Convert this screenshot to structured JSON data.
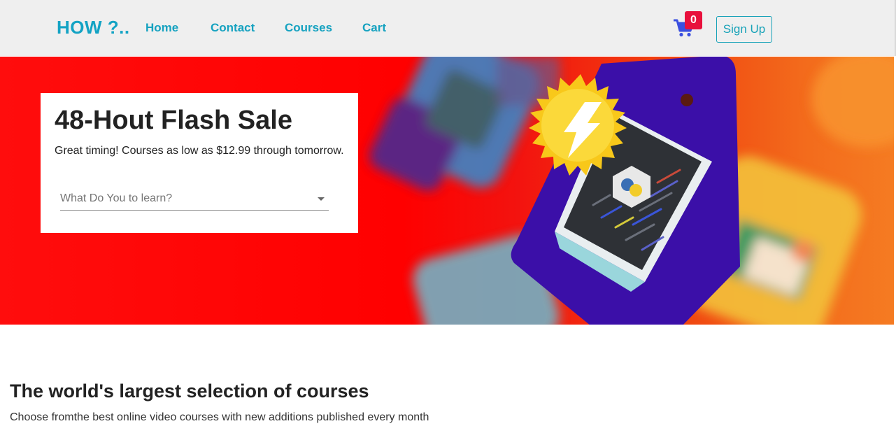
{
  "navbar": {
    "brand": "HOW ?..",
    "links": [
      "Home",
      "Contact",
      "Courses",
      "Cart"
    ],
    "cart_count": "0",
    "signup_label": "Sign Up",
    "cart_icon": "shopping-cart-icon"
  },
  "hero": {
    "title": "48-Hout Flash Sale",
    "subtitle": "Great timing! Courses as low as $12.99 through tomorrow.",
    "search_placeholder": "What Do You to learn?"
  },
  "section": {
    "title": "The world's largest selection of courses",
    "subtitle": "Choose fromthe best online video courses with new additions published every month"
  },
  "colors": {
    "brand": "#13a3c4",
    "badge": "#e8103c",
    "hero_red": "#ff0000",
    "cart_icon": "#3a4fe0"
  }
}
